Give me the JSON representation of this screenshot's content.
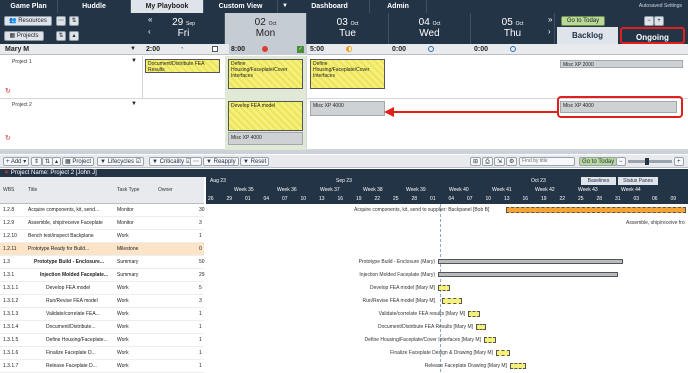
{
  "nav": {
    "tabs": [
      {
        "label": "Game Plan"
      },
      {
        "label": "Huddle"
      },
      {
        "label": "My Playbook"
      },
      {
        "label": "Custom View"
      },
      {
        "label": "Dashboard"
      },
      {
        "label": "Admin"
      }
    ],
    "autosave": "Autosaved Settings"
  },
  "dayheader": {
    "resources_btn": "Resources",
    "projects_btn": "Projects",
    "days": [
      {
        "num": "29",
        "month": "Sep",
        "weekday": "Fri"
      },
      {
        "num": "02",
        "month": "Oct",
        "weekday": "Mon"
      },
      {
        "num": "03",
        "month": "Oct",
        "weekday": "Tue"
      },
      {
        "num": "04",
        "month": "Oct",
        "weekday": "Wed"
      },
      {
        "num": "05",
        "month": "Oct",
        "weekday": "Thu"
      }
    ],
    "go_to_today": "Go to Today",
    "minus": "−",
    "plus": "+",
    "backlog": "Backlog",
    "ongoing": "Ongoing"
  },
  "resource": {
    "name": "Mary M",
    "times": [
      "2:00",
      "8:00",
      "5:00",
      "0:00",
      "0:00"
    ],
    "rows": [
      {
        "label": "Project 1",
        "tasks": [
          "Document/Distribute FEA Results",
          "Define Housing/Faceplate/Cover Interfaces",
          "Define Housing/Faceplate/Cover Interfaces"
        ],
        "backlog": "Misc XP 2000"
      },
      {
        "label": "Project 2",
        "tasks": [
          "Develop FEA model",
          "Misc XP 4000",
          "Misc XP 4000"
        ],
        "backlog": "Misc XP 4000"
      }
    ]
  },
  "toolbar": {
    "add": "Add",
    "project": "Project",
    "lifecycles": "Lifecycles",
    "criticality": "Criticality",
    "reapply": "Reapply",
    "reset": "Reset",
    "find_placeholder": "Find by title",
    "go_to_today": "Go to Today"
  },
  "project": {
    "label": "Project Name: Project 2 [John J]"
  },
  "grid": {
    "headers": {
      "wbs": "WBS",
      "title": "Title",
      "type": "Task Type",
      "owner": "Owner"
    },
    "rows": [
      {
        "wbs": "1.2.8",
        "title": "Acquire components, kit, send...",
        "type": "Monitor",
        "num": "30"
      },
      {
        "wbs": "1.2.9",
        "title": "Assemble, ship/receive Faceplate",
        "type": "Monitor",
        "num": "3"
      },
      {
        "wbs": "1.2.10",
        "title": "Bench test/inspect Backplane",
        "type": "Work",
        "num": "1"
      },
      {
        "wbs": "1.2.11",
        "title": "Prototype Ready for Build...",
        "type": "Milestone",
        "num": "0"
      },
      {
        "wbs": "1.3",
        "title": "Prototype Build - Enclosure...",
        "type": "Summary",
        "num": "50"
      },
      {
        "wbs": "1.3.1",
        "title": "Injection Molded Faceplate...",
        "type": "Summary",
        "num": "29"
      },
      {
        "wbs": "1.3.1.1",
        "title": "Develop FEA model",
        "type": "Work",
        "num": "5"
      },
      {
        "wbs": "1.3.1.2",
        "title": "Run/Revise FEA model",
        "type": "Work",
        "num": "3"
      },
      {
        "wbs": "1.3.1.3",
        "title": "Validate/correlate FEA...",
        "type": "Work",
        "num": "1"
      },
      {
        "wbs": "1.3.1.4",
        "title": "Document/Distribute...",
        "type": "Work",
        "num": "1"
      },
      {
        "wbs": "1.3.1.5",
        "title": "Define Housing/Faceplate...",
        "type": "Work",
        "num": "1"
      },
      {
        "wbs": "1.3.1.6",
        "title": "Finalize Faceplate D...",
        "type": "Work",
        "num": "1"
      },
      {
        "wbs": "1.3.1.7",
        "title": "Release Faceplate D...",
        "type": "Work",
        "num": "1"
      }
    ]
  },
  "gantt": {
    "months": [
      "Aug 23",
      "Sep 23",
      "Oct 23"
    ],
    "weeks": [
      "Week 35",
      "Week 36",
      "Week 37",
      "Week 38",
      "Week 39",
      "Week 40",
      "Week 41",
      "Week 42",
      "Week 43",
      "Week 44"
    ],
    "days": [
      "26",
      "29",
      "01",
      "04",
      "07",
      "10",
      "13",
      "16",
      "19",
      "22",
      "25",
      "28",
      "01",
      "04",
      "07",
      "10",
      "13",
      "16",
      "19",
      "22",
      "25",
      "28",
      "31",
      "03",
      "06",
      "09"
    ],
    "baselines": "Baselines",
    "status_panes": "Status Panes",
    "labels": [
      "Acquire components, kit, send to supplier: Backpanel [Bob B]",
      "Assemble, ship/receive fro",
      "Prototype Build - Enclosure (Mary)",
      "Injection Molded Faceplate (Mary)",
      "Develop FEA model [Mary M]",
      "Run/Revise FEA model [Mary M]",
      "Validate/correlate FEA results [Mary M]",
      "Document/Distribute FEA Results [Mary M]",
      "Define Housing/Faceplate/Cover Interfaces [Mary M]",
      "Finalize Faceplate Design & Drawing [Mary M]",
      "Release Faceplate Drawing [Mary M]"
    ]
  }
}
